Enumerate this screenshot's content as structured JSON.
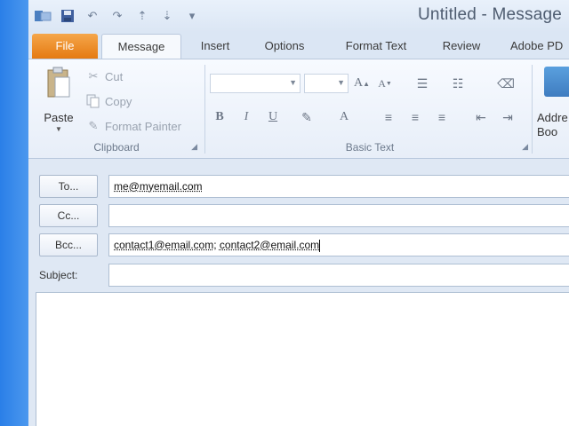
{
  "window": {
    "title": "Untitled - Message"
  },
  "tabs": [
    {
      "label": "File"
    },
    {
      "label": "Message"
    },
    {
      "label": "Insert"
    },
    {
      "label": "Options"
    },
    {
      "label": "Format Text"
    },
    {
      "label": "Review"
    },
    {
      "label": "Adobe PD"
    }
  ],
  "ribbon": {
    "clipboard": {
      "paste_label": "Paste",
      "cut_label": "Cut",
      "copy_label": "Copy",
      "format_painter_label": "Format Painter",
      "group_label": "Clipboard"
    },
    "basic_text": {
      "group_label": "Basic Text"
    },
    "names": {
      "address_book_line1": "Addre",
      "address_book_line2": "Boo"
    }
  },
  "compose": {
    "to_label": "To...",
    "to_value": "me@myemail.com",
    "cc_label": "Cc...",
    "cc_value": "",
    "bcc_label": "Bcc...",
    "bcc_value_1": "contact1@email.com",
    "bcc_separator": ";",
    "bcc_value_2": "contact2@email.com",
    "subject_label": "Subject:",
    "subject_value": ""
  }
}
